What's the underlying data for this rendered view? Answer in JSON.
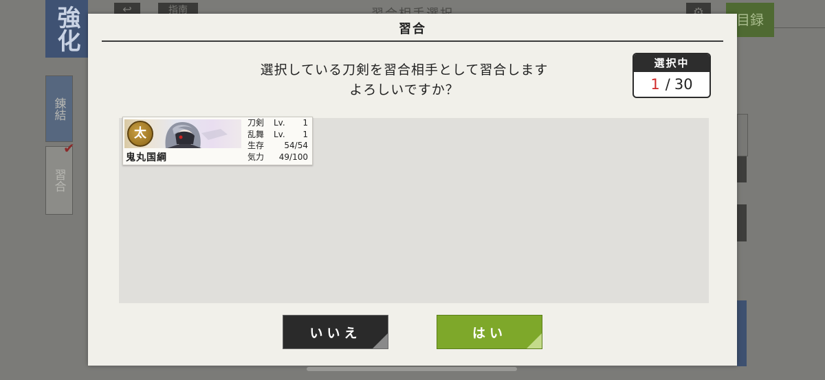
{
  "background": {
    "side_tab_main": "強化",
    "side_tab_1": "錬結",
    "side_tab_2": "習合",
    "screen_title": "習合相手選択",
    "guide_label": "指南",
    "catalog_label": "目録"
  },
  "dialog": {
    "title": "習合",
    "message_line1": "選択している刀剣を習合相手として習合します",
    "message_line2": "よろしいですか？",
    "counter": {
      "label": "選択中",
      "current": "1",
      "separator": "/",
      "total": "30"
    },
    "card": {
      "type_badge": "太",
      "name": "鬼丸国綱",
      "stats": [
        {
          "label": "刀剣",
          "prefix": "Lv.",
          "value": "1"
        },
        {
          "label": "乱舞",
          "prefix": "Lv.",
          "value": "1"
        },
        {
          "label": "生存",
          "prefix": "",
          "value": "54/54"
        },
        {
          "label": "気力",
          "prefix": "",
          "value": "49/100"
        }
      ]
    },
    "buttons": {
      "no": "いいえ",
      "yes": "はい"
    }
  },
  "colors": {
    "accent_yes": "#7ea82a",
    "dark_button": "#2a2a2a",
    "counter_highlight": "#d02828"
  }
}
